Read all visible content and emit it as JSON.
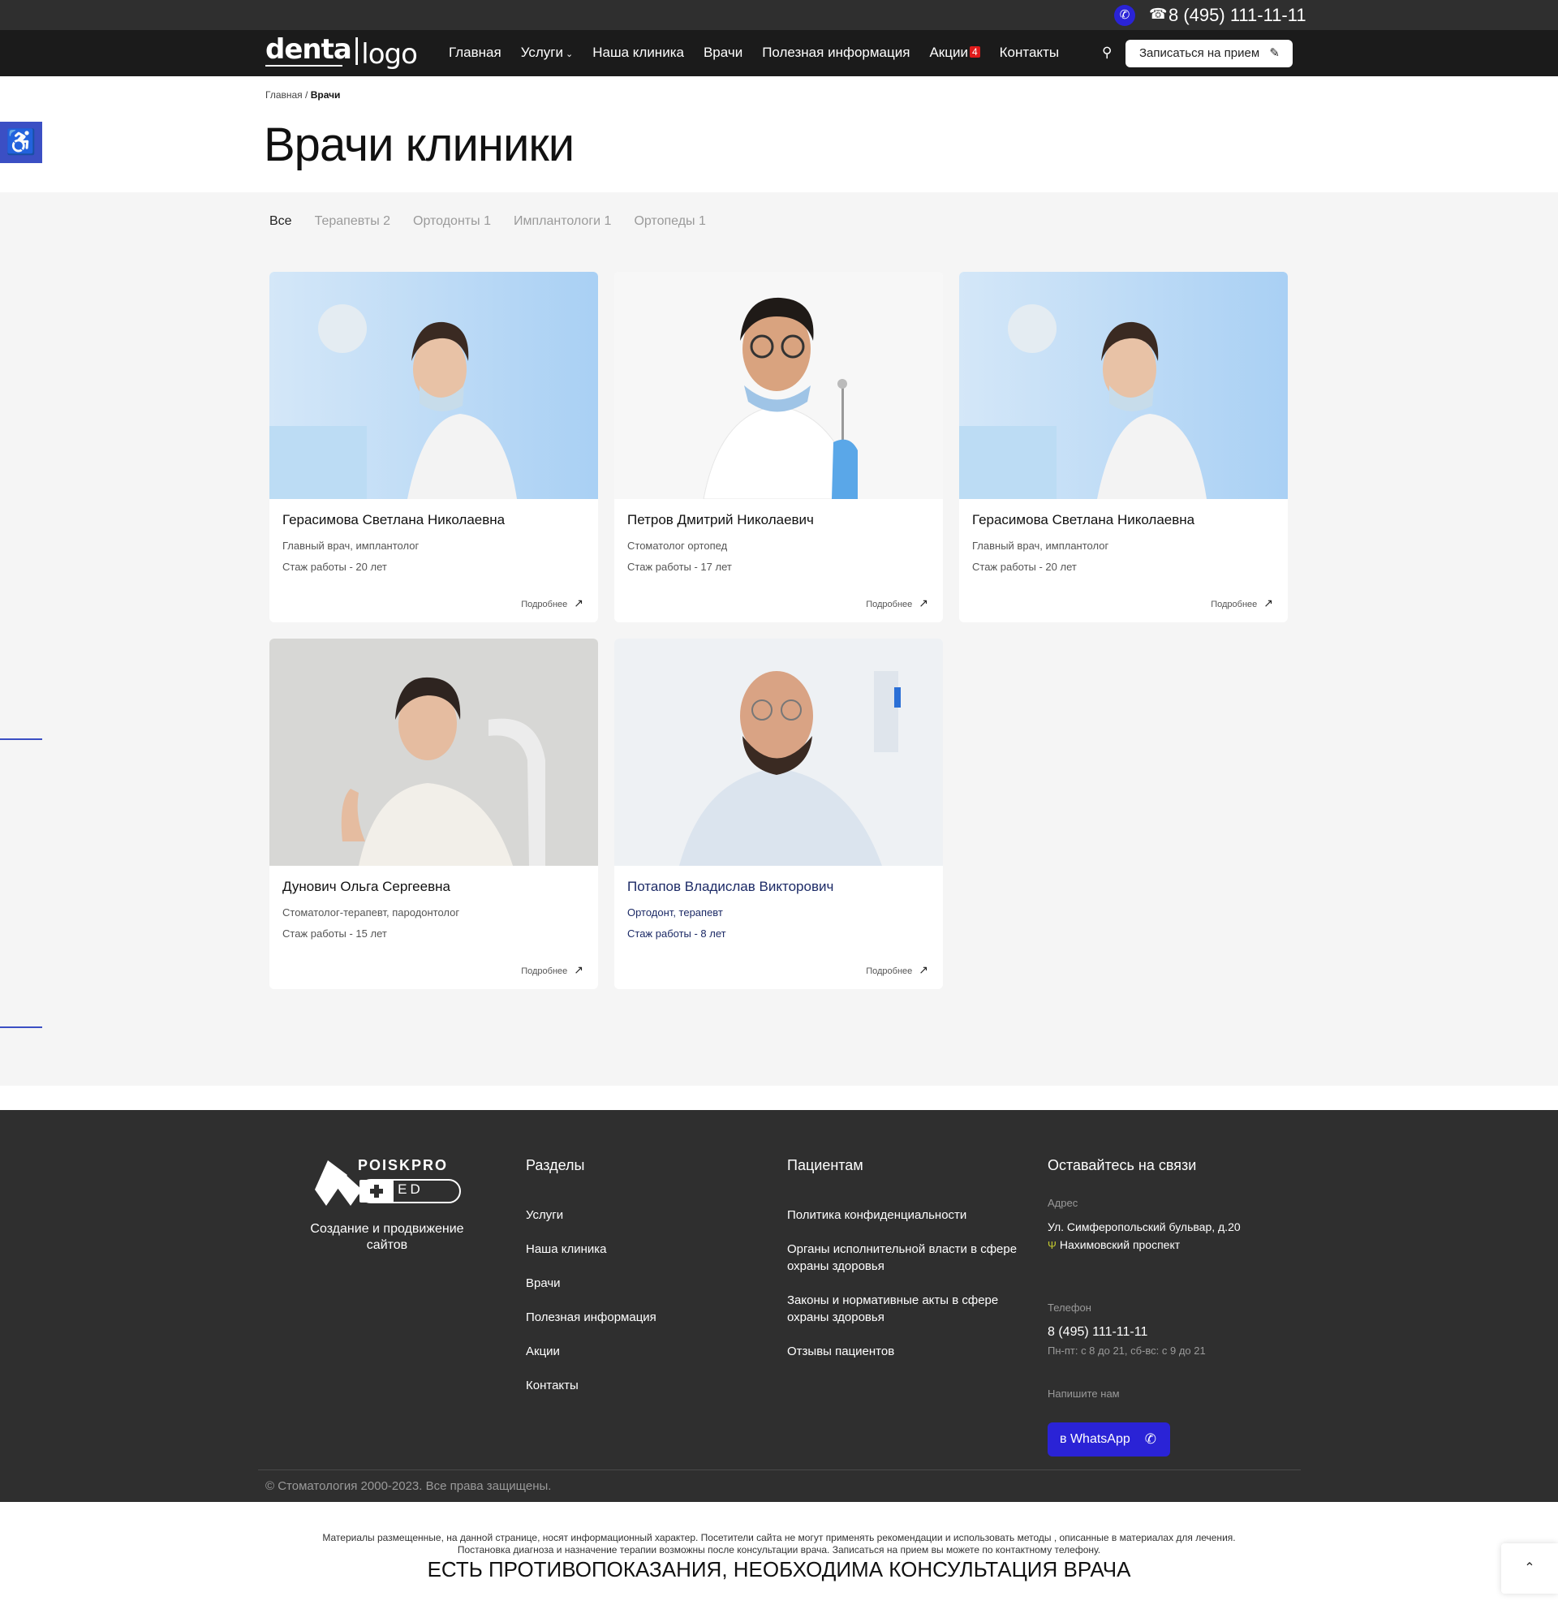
{
  "topbar": {
    "whatsapp_icon": "whatsapp-icon",
    "phone_icon": "phone-icon",
    "phone": "8 (495) 111-11-11"
  },
  "header": {
    "logo": {
      "part1": "denta",
      "part2": "logo"
    },
    "nav": [
      {
        "label": "Главная"
      },
      {
        "label": "Услуги",
        "dropdown": true
      },
      {
        "label": "Наша клиника"
      },
      {
        "label": "Врачи"
      },
      {
        "label": "Полезная информация"
      },
      {
        "label": "Акции",
        "badge": "4"
      },
      {
        "label": "Контакты"
      }
    ],
    "cta_label": "Записаться на прием"
  },
  "breadcrumb": {
    "home": "Главная",
    "separator": " / ",
    "current": "Врачи"
  },
  "page_title": "Врачи клиники",
  "filters": [
    {
      "label": "Все",
      "active": true
    },
    {
      "label": "Терапевты 2"
    },
    {
      "label": "Ортодонты 1"
    },
    {
      "label": "Имплантологи 1"
    },
    {
      "label": "Ортопеды 1"
    }
  ],
  "doctors": [
    {
      "name": "Герасимова Светлана Николаевна",
      "role": "Главный врач, имплантолог",
      "experience": "Стаж работы - 20 лет",
      "more": "Подробнее"
    },
    {
      "name": "Петров Дмитрий Николаевич",
      "role": "Стоматолог ортопед",
      "experience": "Стаж работы - 17 лет",
      "more": "Подробнее"
    },
    {
      "name": "Герасимова Светлана Николаевна",
      "role": "Главный врач, имплантолог",
      "experience": "Стаж работы - 20 лет",
      "more": "Подробнее"
    },
    {
      "name": "Дунович Ольга Сергеевна",
      "role": "Стоматолог-терапевт, пародонтолог",
      "experience": "Стаж работы - 15 лет",
      "more": "Подробнее"
    },
    {
      "name": "Потапов Владислав Викторович",
      "role": "Ортодонт, терапевт",
      "experience": "Стаж работы - 8 лет",
      "more": "Подробнее"
    }
  ],
  "footer": {
    "logo": {
      "line1": "POISKPRO",
      "line2": "MED"
    },
    "tagline": "Создание и продвижение сайтов",
    "sections": {
      "title": "Разделы",
      "links": [
        "Услуги",
        "Наша клиника",
        "Врачи",
        "Полезная информация",
        "Акции",
        "Контакты"
      ]
    },
    "patients": {
      "title": "Пациентам",
      "links": [
        "Политика конфиденциальности",
        "Органы исполнительной власти в сфере охраны здоровья",
        "Законы и нормативные акты в сфере охраны здоровья",
        "Отзывы пациентов"
      ]
    },
    "contacts": {
      "title": "Оставайтесь на связи",
      "address_label": "Адрес",
      "address": "Ул. Симферопольский бульвар, д.20",
      "metro": "Нахимовский проспект",
      "phone_label": "Телефон",
      "phone": "8 (495) 111-11-11",
      "hours": "Пн-пт: с 8 до 21, сб-вс: с 9 до 21",
      "write_label": "Напишите нам",
      "whatsapp_btn": "в WhatsApp"
    },
    "copyright": "© Стоматология 2000-2023. Все права защищены."
  },
  "disclaimer": {
    "line1": "Материалы размещенные, на данной странице, носят информационный характер. Посетители сайта не могут применять рекомендации и использовать методы , описанные в материалах для лечения.",
    "line2": "Постановка диагноза и назначение терапии возможны после консультации врача. Записаться на прием вы можете по контактному телефону.",
    "warning": "ЕСТЬ ПРОТИВОПОКАЗАНИЯ, НЕОБХОДИМА КОНСУЛЬТАЦИЯ ВРАЧА"
  },
  "colors": {
    "topbar": "#2f2f2f",
    "header": "#1b1b1b",
    "accent_blue": "#2a23d6",
    "accessibility": "#3b4fc4",
    "badge_red": "#e01b1b",
    "content_bg": "#f5f5f5",
    "footer_bg": "#2f2f2f"
  }
}
